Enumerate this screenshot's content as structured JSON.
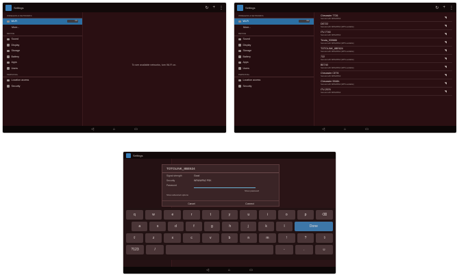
{
  "screen1": {
    "title": "Settings",
    "actions": [
      "↻",
      "+",
      "⋮"
    ],
    "sections": {
      "wireless": "WIRELESS & NETWORKS",
      "device": "DEVICE",
      "personal": "PERSONAL"
    },
    "wifi": {
      "label": "Wi-Fi",
      "toggle": "ON"
    },
    "more": "More...",
    "device_items": [
      "Sound",
      "Display",
      "Storage",
      "Battery",
      "Apps",
      "Users"
    ],
    "personal_items": [
      "Location access",
      "Security"
    ],
    "center_message": "To see available networks, turn Wi-Fi on."
  },
  "screen2": {
    "title": "Settings",
    "actions": [
      "↻",
      "+",
      "⋮"
    ],
    "sections": {
      "wireless": "WIRELESS & NETWORKS",
      "device": "DEVICE",
      "personal": "PERSONAL"
    },
    "wifi": {
      "label": "Wi-Fi",
      "toggle": "ON"
    },
    "more": "More...",
    "device_items": [
      "Sound",
      "Display",
      "Storage",
      "Battery",
      "Apps",
      "Users"
    ],
    "personal_items": [
      "Location access",
      "Security"
    ],
    "networks": [
      {
        "ssid": "Chevaster 7726",
        "security": "Secured with WPA/WPA2"
      },
      {
        "ssid": "DE722",
        "security": "Secured with WPA/WPA2 (WPS available)"
      },
      {
        "ssid": "ITV-7740",
        "security": "Secured with WPA/WPA2"
      },
      {
        "ssid": "Tenda_939686",
        "security": "Secured with WPA/WPA2 (WPS available)"
      },
      {
        "ssid": "TOTOLINK_8BE624",
        "security": "Secured with WPA/WPA2 (WPS available)"
      },
      {
        "ssid": "722",
        "security": "Secured with WPA/WPA2 (WPS available)"
      },
      {
        "ssid": "BE740",
        "security": "Secured with WPA/WPA2 (WPS available)"
      },
      {
        "ssid": "Chevaster CE76",
        "security": "Secured with WPA/WPA2"
      },
      {
        "ssid": "Chevaster 9946h",
        "security": "Secured with WPA/WPA2 (WPS available)"
      },
      {
        "ssid": "ITV-2576",
        "security": "Secured with WPA/WPA2"
      }
    ]
  },
  "screen3": {
    "title": "Settings",
    "dialog": {
      "ssid": "TOTOLINK_8BE624",
      "signal_label": "Signal strength",
      "signal_value": "Good",
      "security_label": "Security",
      "security_value": "WPA/WPA2 PSK",
      "password_label": "Password",
      "show_password": "Show password",
      "advanced": "Show advanced options",
      "cancel": "Cancel",
      "connect": "Connect"
    },
    "keyboard": {
      "row1": [
        "q",
        "w",
        "e",
        "r",
        "t",
        "y",
        "u",
        "i",
        "o",
        "p",
        "⌫"
      ],
      "row2": [
        "a",
        "s",
        "d",
        "f",
        "g",
        "h",
        "j",
        "k",
        "l",
        "Done"
      ],
      "row3": [
        "⇧",
        "z",
        "x",
        "c",
        "v",
        "b",
        "n",
        "m",
        "!",
        "?",
        "⇧"
      ],
      "row4": [
        "?123",
        "/",
        "",
        "-",
        ".",
        "☺"
      ]
    }
  }
}
